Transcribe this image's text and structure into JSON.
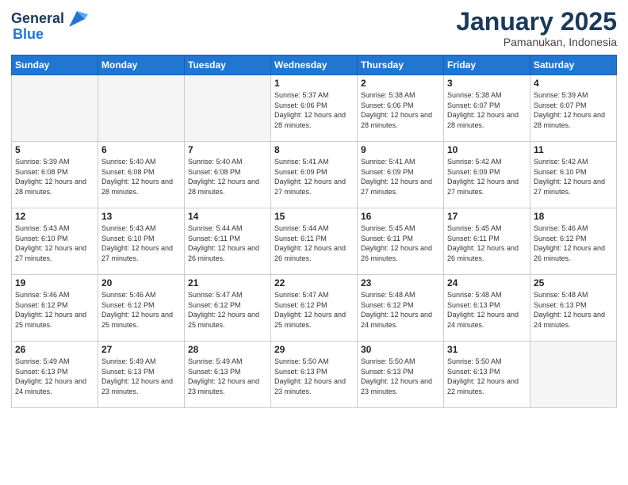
{
  "header": {
    "logo_general": "General",
    "logo_blue": "Blue",
    "month_title": "January 2025",
    "location": "Pamanukan, Indonesia"
  },
  "weekdays": [
    "Sunday",
    "Monday",
    "Tuesday",
    "Wednesday",
    "Thursday",
    "Friday",
    "Saturday"
  ],
  "weeks": [
    [
      {
        "day": "",
        "sunrise": "",
        "sunset": "",
        "daylight": ""
      },
      {
        "day": "",
        "sunrise": "",
        "sunset": "",
        "daylight": ""
      },
      {
        "day": "",
        "sunrise": "",
        "sunset": "",
        "daylight": ""
      },
      {
        "day": "1",
        "sunrise": "Sunrise: 5:37 AM",
        "sunset": "Sunset: 6:06 PM",
        "daylight": "Daylight: 12 hours and 28 minutes."
      },
      {
        "day": "2",
        "sunrise": "Sunrise: 5:38 AM",
        "sunset": "Sunset: 6:06 PM",
        "daylight": "Daylight: 12 hours and 28 minutes."
      },
      {
        "day": "3",
        "sunrise": "Sunrise: 5:38 AM",
        "sunset": "Sunset: 6:07 PM",
        "daylight": "Daylight: 12 hours and 28 minutes."
      },
      {
        "day": "4",
        "sunrise": "Sunrise: 5:39 AM",
        "sunset": "Sunset: 6:07 PM",
        "daylight": "Daylight: 12 hours and 28 minutes."
      }
    ],
    [
      {
        "day": "5",
        "sunrise": "Sunrise: 5:39 AM",
        "sunset": "Sunset: 6:08 PM",
        "daylight": "Daylight: 12 hours and 28 minutes."
      },
      {
        "day": "6",
        "sunrise": "Sunrise: 5:40 AM",
        "sunset": "Sunset: 6:08 PM",
        "daylight": "Daylight: 12 hours and 28 minutes."
      },
      {
        "day": "7",
        "sunrise": "Sunrise: 5:40 AM",
        "sunset": "Sunset: 6:08 PM",
        "daylight": "Daylight: 12 hours and 28 minutes."
      },
      {
        "day": "8",
        "sunrise": "Sunrise: 5:41 AM",
        "sunset": "Sunset: 6:09 PM",
        "daylight": "Daylight: 12 hours and 27 minutes."
      },
      {
        "day": "9",
        "sunrise": "Sunrise: 5:41 AM",
        "sunset": "Sunset: 6:09 PM",
        "daylight": "Daylight: 12 hours and 27 minutes."
      },
      {
        "day": "10",
        "sunrise": "Sunrise: 5:42 AM",
        "sunset": "Sunset: 6:09 PM",
        "daylight": "Daylight: 12 hours and 27 minutes."
      },
      {
        "day": "11",
        "sunrise": "Sunrise: 5:42 AM",
        "sunset": "Sunset: 6:10 PM",
        "daylight": "Daylight: 12 hours and 27 minutes."
      }
    ],
    [
      {
        "day": "12",
        "sunrise": "Sunrise: 5:43 AM",
        "sunset": "Sunset: 6:10 PM",
        "daylight": "Daylight: 12 hours and 27 minutes."
      },
      {
        "day": "13",
        "sunrise": "Sunrise: 5:43 AM",
        "sunset": "Sunset: 6:10 PM",
        "daylight": "Daylight: 12 hours and 27 minutes."
      },
      {
        "day": "14",
        "sunrise": "Sunrise: 5:44 AM",
        "sunset": "Sunset: 6:11 PM",
        "daylight": "Daylight: 12 hours and 26 minutes."
      },
      {
        "day": "15",
        "sunrise": "Sunrise: 5:44 AM",
        "sunset": "Sunset: 6:11 PM",
        "daylight": "Daylight: 12 hours and 26 minutes."
      },
      {
        "day": "16",
        "sunrise": "Sunrise: 5:45 AM",
        "sunset": "Sunset: 6:11 PM",
        "daylight": "Daylight: 12 hours and 26 minutes."
      },
      {
        "day": "17",
        "sunrise": "Sunrise: 5:45 AM",
        "sunset": "Sunset: 6:11 PM",
        "daylight": "Daylight: 12 hours and 26 minutes."
      },
      {
        "day": "18",
        "sunrise": "Sunrise: 5:46 AM",
        "sunset": "Sunset: 6:12 PM",
        "daylight": "Daylight: 12 hours and 26 minutes."
      }
    ],
    [
      {
        "day": "19",
        "sunrise": "Sunrise: 5:46 AM",
        "sunset": "Sunset: 6:12 PM",
        "daylight": "Daylight: 12 hours and 25 minutes."
      },
      {
        "day": "20",
        "sunrise": "Sunrise: 5:46 AM",
        "sunset": "Sunset: 6:12 PM",
        "daylight": "Daylight: 12 hours and 25 minutes."
      },
      {
        "day": "21",
        "sunrise": "Sunrise: 5:47 AM",
        "sunset": "Sunset: 6:12 PM",
        "daylight": "Daylight: 12 hours and 25 minutes."
      },
      {
        "day": "22",
        "sunrise": "Sunrise: 5:47 AM",
        "sunset": "Sunset: 6:12 PM",
        "daylight": "Daylight: 12 hours and 25 minutes."
      },
      {
        "day": "23",
        "sunrise": "Sunrise: 5:48 AM",
        "sunset": "Sunset: 6:12 PM",
        "daylight": "Daylight: 12 hours and 24 minutes."
      },
      {
        "day": "24",
        "sunrise": "Sunrise: 5:48 AM",
        "sunset": "Sunset: 6:13 PM",
        "daylight": "Daylight: 12 hours and 24 minutes."
      },
      {
        "day": "25",
        "sunrise": "Sunrise: 5:48 AM",
        "sunset": "Sunset: 6:13 PM",
        "daylight": "Daylight: 12 hours and 24 minutes."
      }
    ],
    [
      {
        "day": "26",
        "sunrise": "Sunrise: 5:49 AM",
        "sunset": "Sunset: 6:13 PM",
        "daylight": "Daylight: 12 hours and 24 minutes."
      },
      {
        "day": "27",
        "sunrise": "Sunrise: 5:49 AM",
        "sunset": "Sunset: 6:13 PM",
        "daylight": "Daylight: 12 hours and 23 minutes."
      },
      {
        "day": "28",
        "sunrise": "Sunrise: 5:49 AM",
        "sunset": "Sunset: 6:13 PM",
        "daylight": "Daylight: 12 hours and 23 minutes."
      },
      {
        "day": "29",
        "sunrise": "Sunrise: 5:50 AM",
        "sunset": "Sunset: 6:13 PM",
        "daylight": "Daylight: 12 hours and 23 minutes."
      },
      {
        "day": "30",
        "sunrise": "Sunrise: 5:50 AM",
        "sunset": "Sunset: 6:13 PM",
        "daylight": "Daylight: 12 hours and 23 minutes."
      },
      {
        "day": "31",
        "sunrise": "Sunrise: 5:50 AM",
        "sunset": "Sunset: 6:13 PM",
        "daylight": "Daylight: 12 hours and 22 minutes."
      },
      {
        "day": "",
        "sunrise": "",
        "sunset": "",
        "daylight": ""
      }
    ]
  ]
}
